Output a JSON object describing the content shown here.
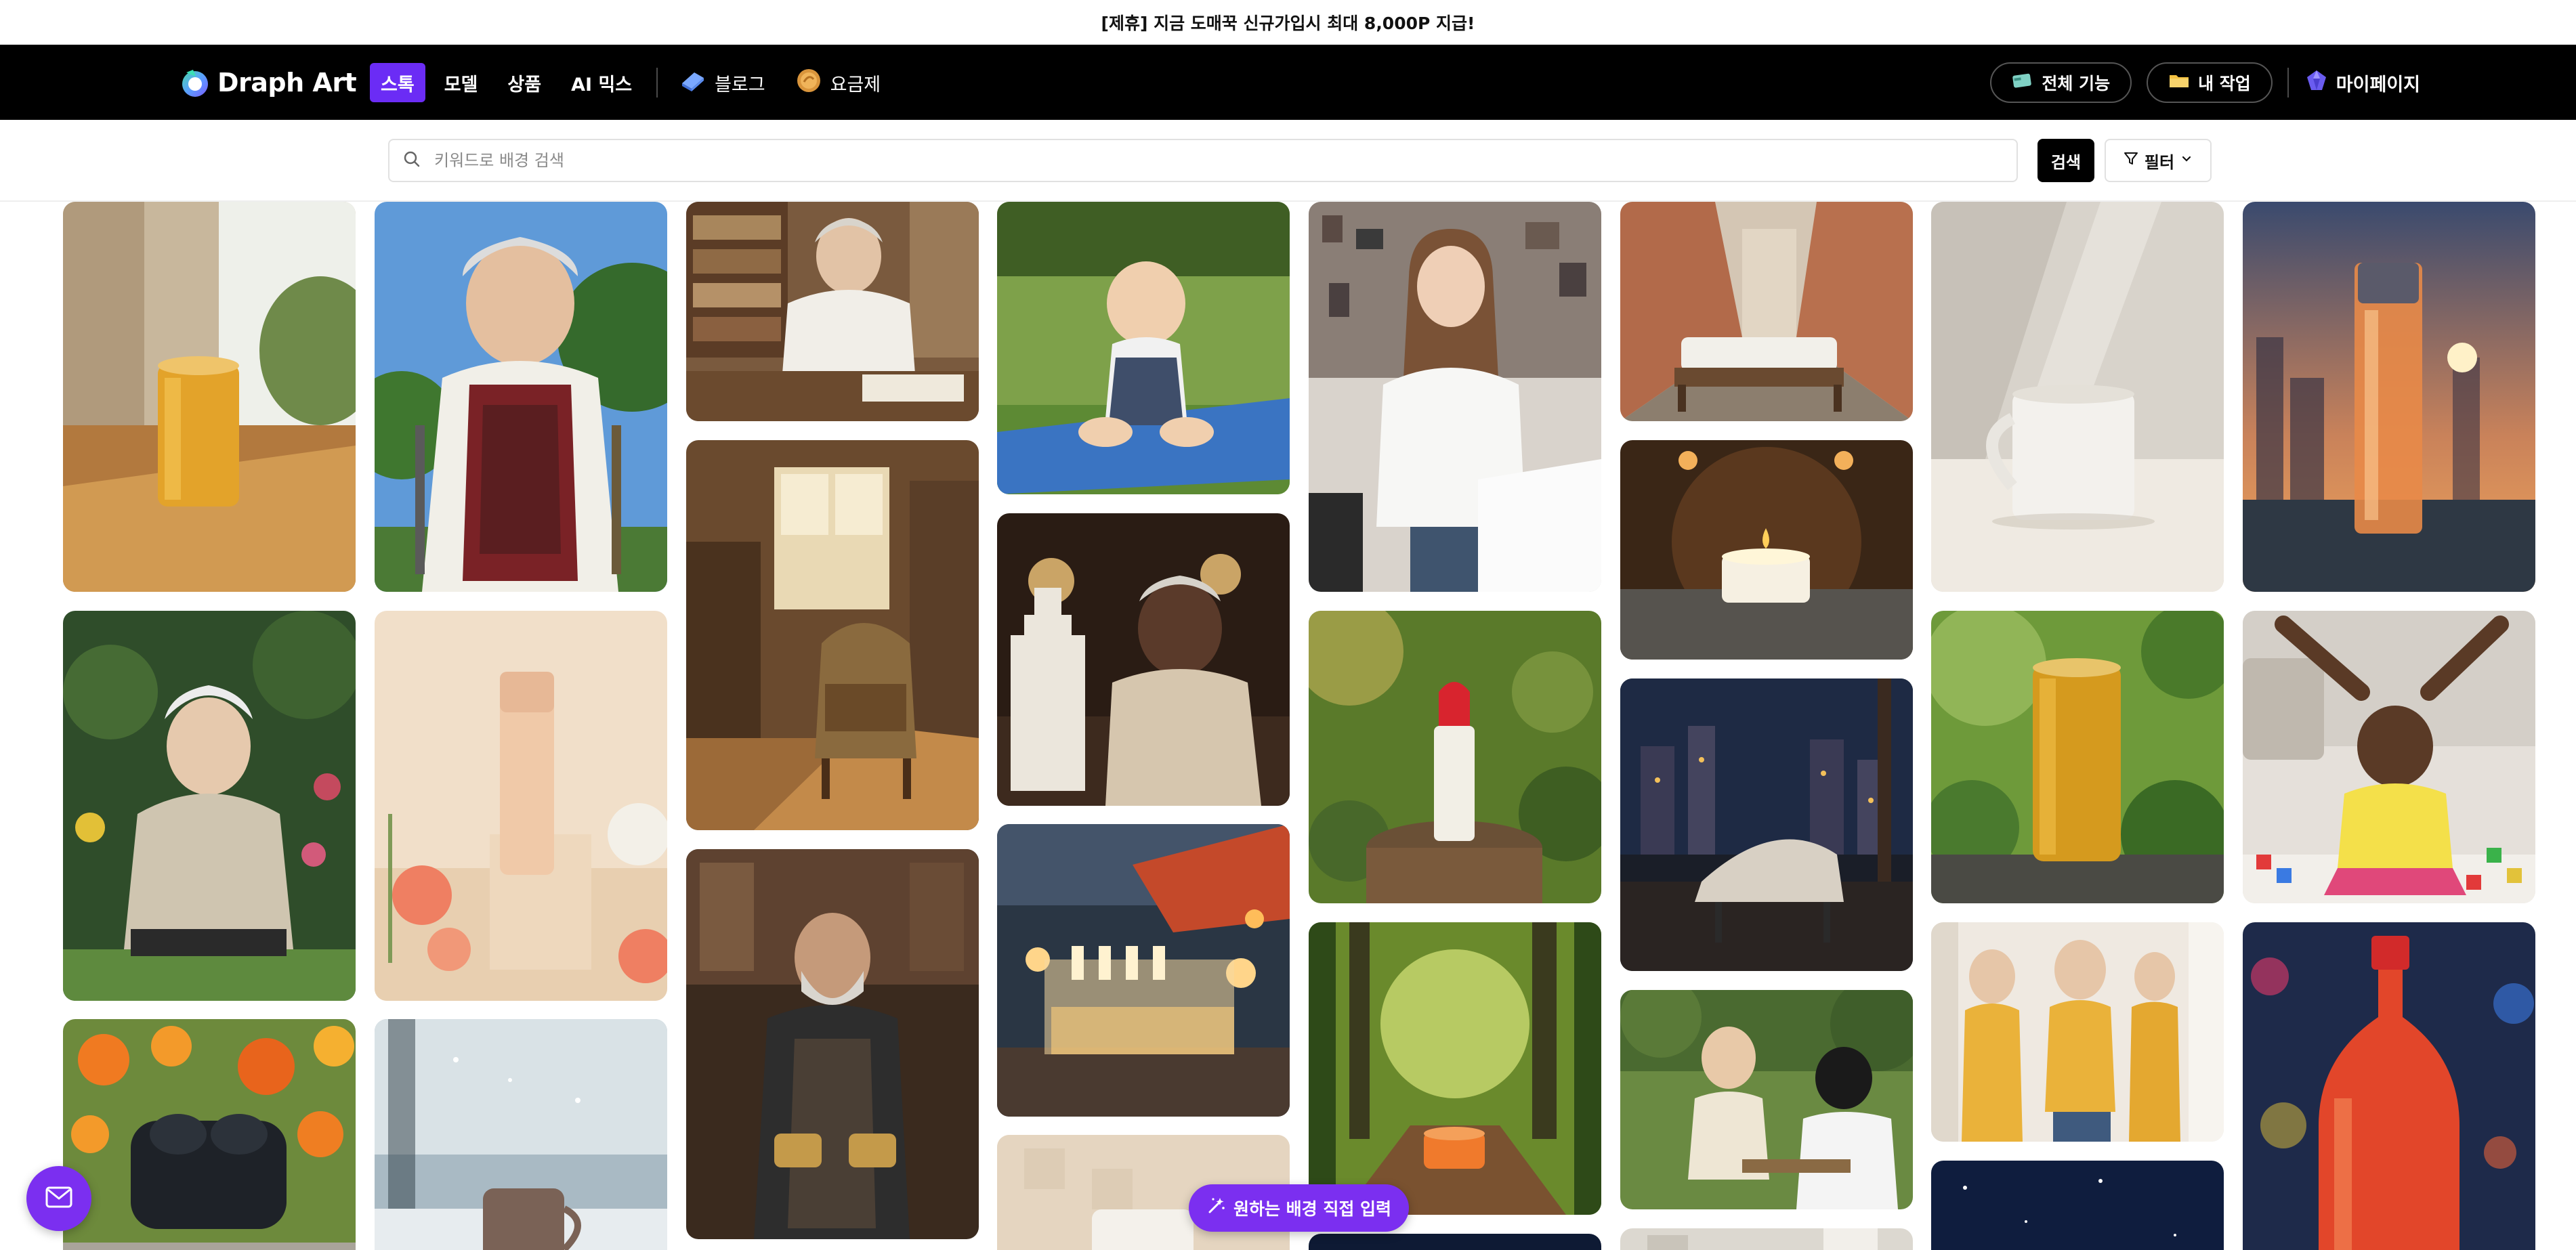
{
  "promo": {
    "text": "[제휴] 지금 도매꾹 신규가입시 최대 8,000P 지급!"
  },
  "header": {
    "logo_text": "Draph Art",
    "nav": [
      {
        "label": "스톡",
        "active": true
      },
      {
        "label": "모델",
        "active": false
      },
      {
        "label": "상품",
        "active": false
      },
      {
        "label": "AI 믹스",
        "active": false
      }
    ],
    "nav_links": [
      {
        "label": "블로그",
        "icon": "book-icon"
      },
      {
        "label": "요금제",
        "icon": "coin-icon"
      }
    ],
    "right": {
      "all_features": "전체 기능",
      "my_work": "내 작업",
      "my_page": "마이페이지"
    }
  },
  "search": {
    "placeholder": "키워드로 배경 검색",
    "value": "",
    "button_label": "검색",
    "filter_label": "필터"
  },
  "gallery": {
    "images": [
      {
        "subject": "golden-can-on-table"
      },
      {
        "subject": "smiling-grandmother-with-tools"
      },
      {
        "subject": "elderly-woman-at-desk-library"
      },
      {
        "subject": "baby-sitting-on-yoga-mat"
      },
      {
        "subject": "young-woman-at-desk"
      },
      {
        "subject": "bed-in-arcade-street"
      },
      {
        "subject": "white-mug-sunlight"
      },
      {
        "subject": "bottle-at-sunset-city"
      },
      {
        "subject": "elderly-man-in-garden"
      },
      {
        "subject": "cosmetic-tube-with-flowers"
      },
      {
        "subject": "armchair-in-wooden-room"
      },
      {
        "subject": "elderly-woman-with-miniature-building"
      },
      {
        "subject": "red-lipstick-on-stump"
      },
      {
        "subject": "candle-on-table"
      },
      {
        "subject": "golden-can-in-leaves"
      },
      {
        "subject": "baby-stretching-with-blocks"
      },
      {
        "subject": "earbuds-case-in-flowers"
      },
      {
        "subject": "mug-in-snow"
      },
      {
        "subject": "craftsman-in-workshop"
      },
      {
        "subject": "glass-display-at-night-market"
      },
      {
        "subject": "jar-on-forest-path"
      },
      {
        "subject": "chair-by-night-city-window"
      },
      {
        "subject": "woman-in-mirrors"
      },
      {
        "subject": "red-soda-bottle-bokeh"
      },
      {
        "subject": "elderly-man-with-child-in-park"
      },
      {
        "subject": "mug-beige-background"
      },
      {
        "subject": "night-sky"
      },
      {
        "subject": "night-scene"
      },
      {
        "subject": "light-interior"
      }
    ]
  },
  "floating": {
    "custom_background_label": "원하는 배경 직접 입력",
    "mail_icon": "mail-icon"
  },
  "colors": {
    "accent": "#6b2cf5",
    "header_bg": "#000000",
    "floating_purple": "#7b2ff0"
  }
}
